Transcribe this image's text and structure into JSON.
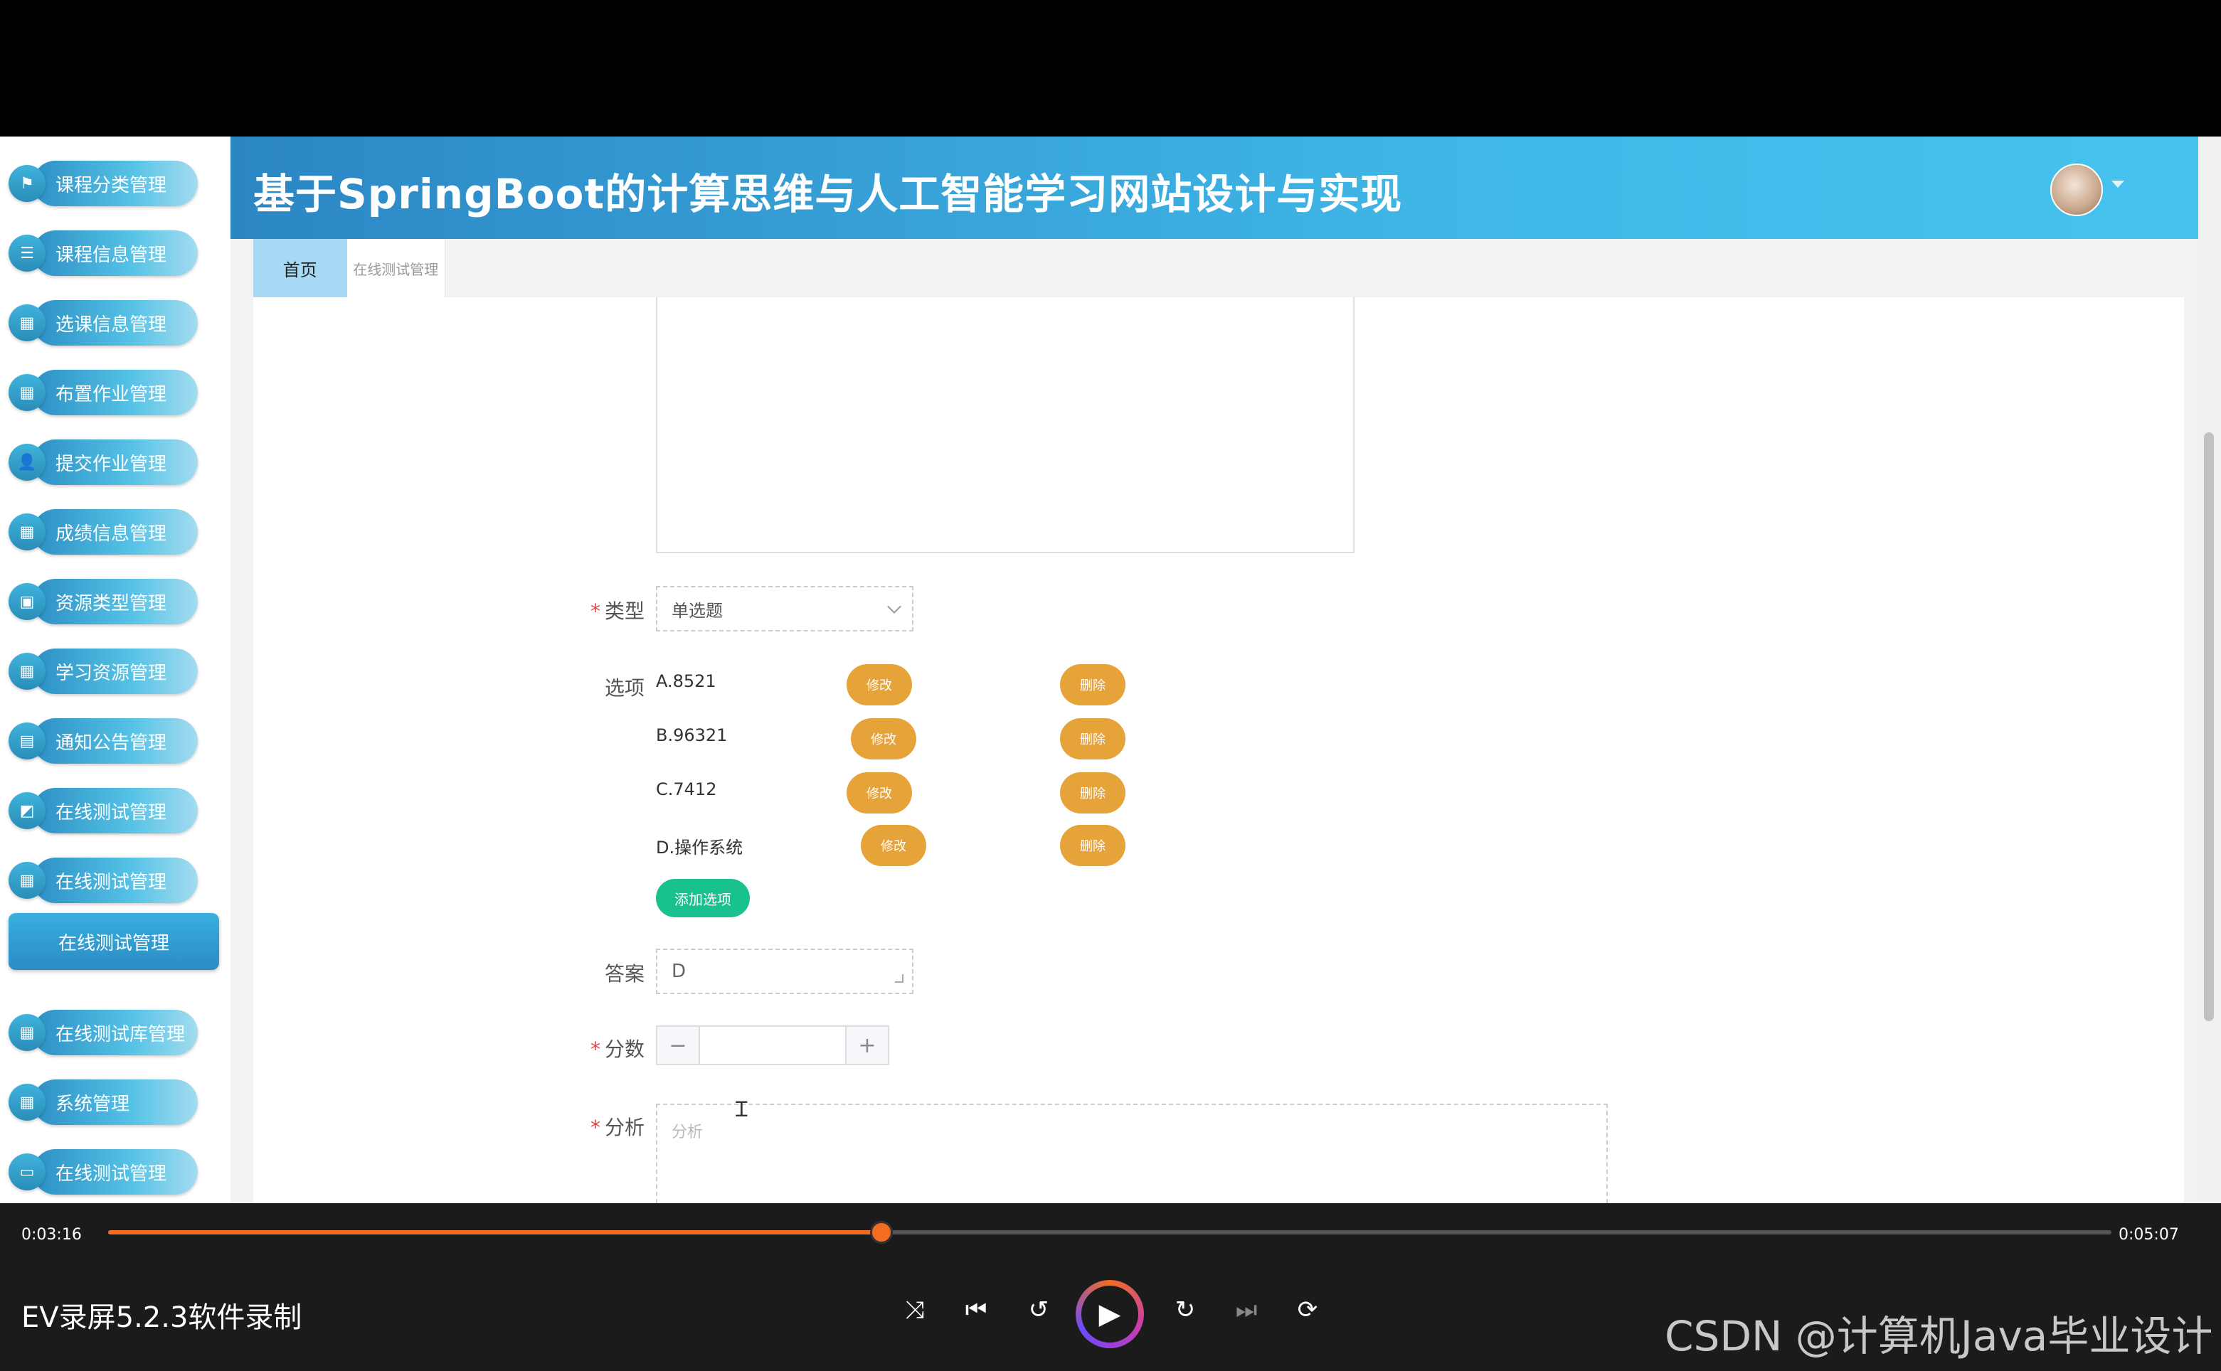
{
  "sidebar": {
    "items": [
      {
        "label": "课程分类管理",
        "icon": "flag-icon"
      },
      {
        "label": "课程信息管理",
        "icon": "list-icon"
      },
      {
        "label": "选课信息管理",
        "icon": "grid-icon"
      },
      {
        "label": "布置作业管理",
        "icon": "grid-icon"
      },
      {
        "label": "提交作业管理",
        "icon": "user-icon"
      },
      {
        "label": "成绩信息管理",
        "icon": "grid-icon"
      },
      {
        "label": "资源类型管理",
        "icon": "briefcase-icon"
      },
      {
        "label": "学习资源管理",
        "icon": "grid-icon"
      },
      {
        "label": "通知公告管理",
        "icon": "table-icon"
      },
      {
        "label": "在线测试管理",
        "icon": "chart-icon"
      },
      {
        "label": "在线测试管理",
        "icon": "grid-icon"
      }
    ],
    "active_label": "在线测试管理",
    "items_bottom": [
      {
        "label": "在线测试库管理",
        "icon": "grid-icon"
      },
      {
        "label": "系统管理",
        "icon": "grid-icon"
      },
      {
        "label": "在线测试管理",
        "icon": "screen-icon"
      }
    ]
  },
  "header": {
    "title": "基于SpringBoot的计算思维与人工智能学习网站设计与实现"
  },
  "tabs": {
    "home": "首页",
    "current": "在线测试管理"
  },
  "form": {
    "type_label": "类型",
    "type_value": "单选题",
    "options_label": "选项",
    "options": [
      {
        "text": "A.8521",
        "edit": "修改",
        "delete": "删除"
      },
      {
        "text": "B.96321",
        "edit": "修改",
        "delete": "删除"
      },
      {
        "text": "C.7412",
        "edit": "修改",
        "delete": "删除"
      },
      {
        "text": "D.操作系统",
        "edit": "修改",
        "delete": "删除"
      }
    ],
    "add_option": "添加选项",
    "answer_label": "答案",
    "answer_value": "D",
    "score_label": "分数",
    "score_minus": "−",
    "score_plus": "+",
    "analysis_label": "分析",
    "analysis_placeholder": "分析"
  },
  "player": {
    "current_time": "0:03:16",
    "total_time": "0:05:07",
    "progress": 0.386,
    "recorder_label": "EV录屏5.2.3软件录制",
    "watermark": "CSDN @计算机Java毕业设计",
    "accent": "#f26d21"
  }
}
